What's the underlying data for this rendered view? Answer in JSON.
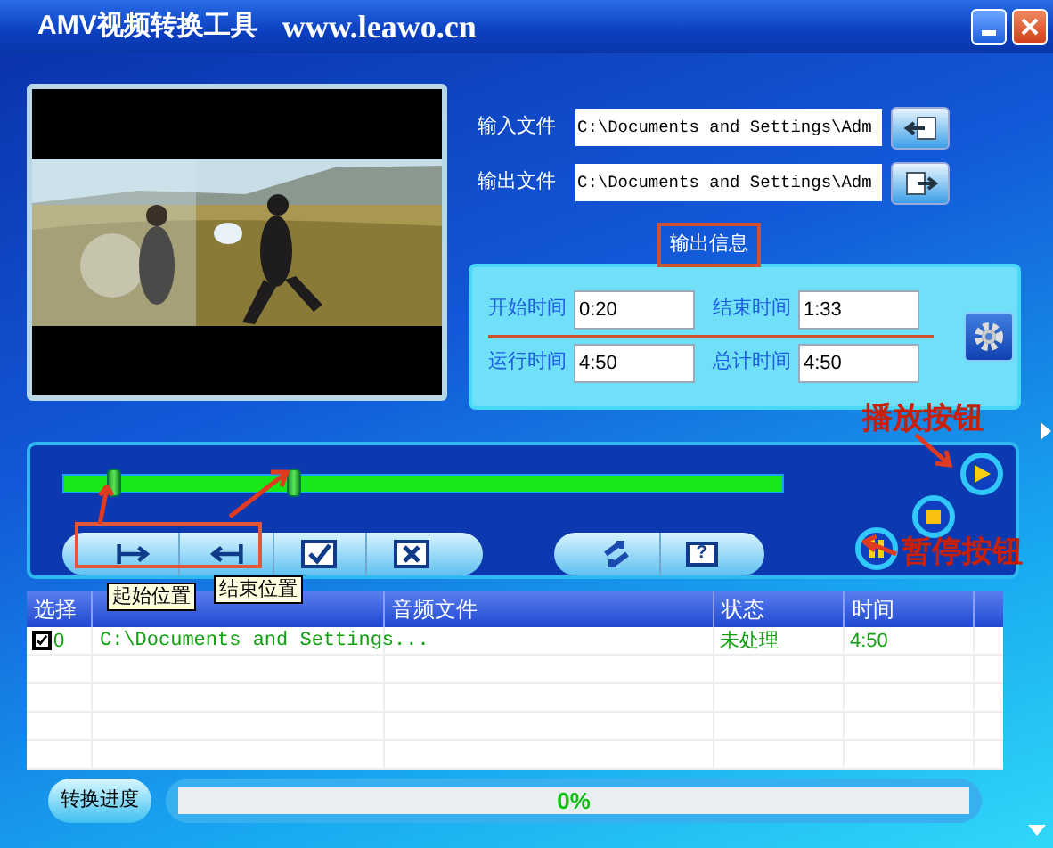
{
  "window": {
    "title": "AMV视频转换工具",
    "website": "www.leawo.cn"
  },
  "files": [
    {
      "label": "输入文件",
      "value": "C:\\Documents and Settings\\Adm"
    },
    {
      "label": "输出文件",
      "value": "C:\\Documents and Settings\\Adm"
    }
  ],
  "output_info": {
    "title": "输出信息",
    "fields": [
      {
        "label": "开始时间",
        "value": "0:20"
      },
      {
        "label": "结束时间",
        "value": "1:33"
      },
      {
        "label": "运行时间",
        "value": "4:50"
      },
      {
        "label": "总计时间",
        "value": "4:50"
      }
    ]
  },
  "slider": {
    "thumbs": [
      {
        "level": 0.07
      },
      {
        "level": 0.32
      }
    ]
  },
  "toolbar": {
    "help": "?"
  },
  "table": {
    "columns": [
      {
        "label": "选择"
      },
      {},
      {
        "label": "音频文件"
      },
      {
        "label": "状态"
      },
      {
        "label": "时间"
      }
    ],
    "rows": [
      {
        "checked": true,
        "index": "0",
        "file": "C:\\Documents and Settings...",
        "status": "未处理",
        "time": "4:50"
      }
    ]
  },
  "progress": {
    "button": "转换进度",
    "level": 0,
    "reading": "0%"
  },
  "annotations": {
    "tooltips": [
      "起始位置",
      "结束位置"
    ],
    "callouts": [
      "播放按钮",
      "暂停按钮"
    ]
  }
}
